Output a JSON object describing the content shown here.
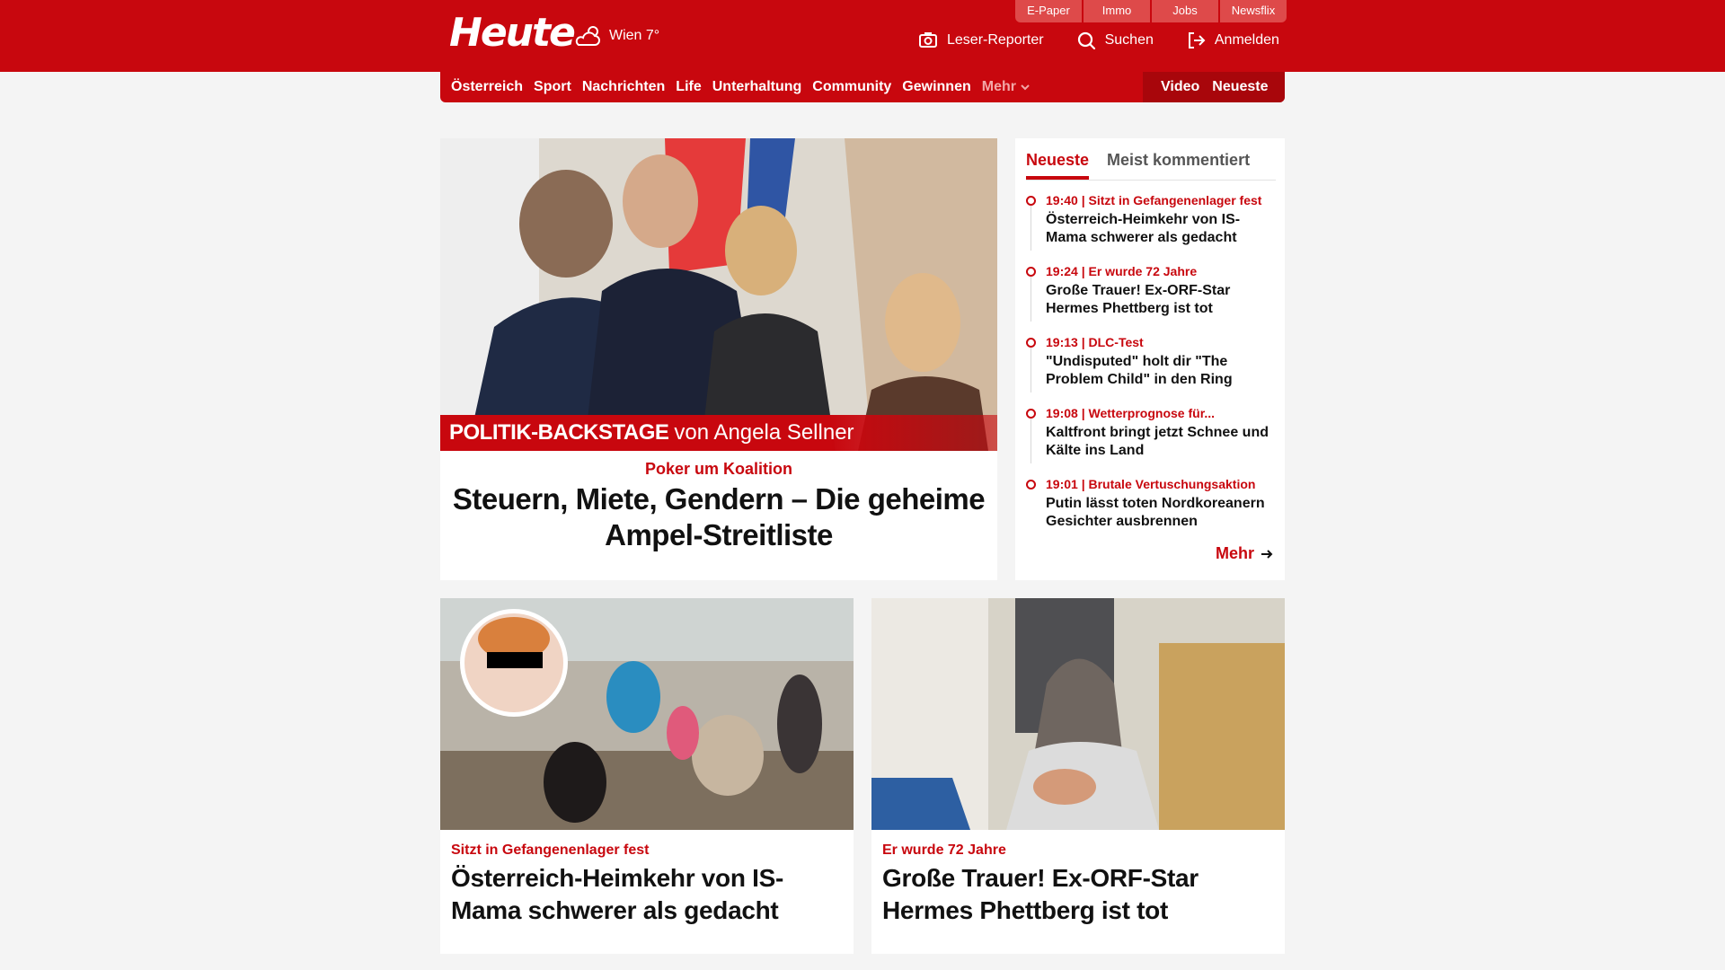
{
  "header": {
    "logo": "Heute",
    "weather": "Wien 7°",
    "service_tabs": [
      "E-Paper",
      "Immo",
      "Jobs",
      "Newsflix"
    ],
    "actions": {
      "leser_reporter": "Leser-Reporter",
      "search": "Suchen",
      "login": "Anmelden"
    },
    "brand_color": "#c8070e"
  },
  "nav": {
    "items": [
      "Österreich",
      "Sport",
      "Nachrichten",
      "Life",
      "Unterhaltung",
      "Community",
      "Gewinnen"
    ],
    "more": "Mehr",
    "right_items": [
      "Video",
      "Neueste"
    ]
  },
  "hero": {
    "banner_bold": "POLITIK-BACKSTAGE",
    "banner_rest": "von Angela Sellner",
    "kicker": "Poker um Koalition",
    "title": "Steuern, Miete, Gendern – Die geheime Ampel-Streitliste"
  },
  "sidebar": {
    "tabs": [
      "Neueste",
      "Meist kommentiert"
    ],
    "items": [
      {
        "meta": "19:40 | Sitzt in Gefangenenlager fest",
        "title": "Österreich-Heimkehr von IS-Mama schwerer als gedacht"
      },
      {
        "meta": "19:24 | Er wurde 72 Jahre",
        "title": "Große Trauer! Ex-ORF-Star Hermes Phettberg ist tot"
      },
      {
        "meta": "19:13 | DLC-Test",
        "title": "\"Undisputed\" holt dir \"The Problem Child\" in den Ring"
      },
      {
        "meta": "19:08 | Wetterprognose für...",
        "title": "Kaltfront bringt jetzt Schnee und Kälte ins Land"
      },
      {
        "meta": "19:01 | Brutale Vertuschungsaktion",
        "title": "Putin lässt toten Nordkoreanern Gesichter ausbrennen"
      }
    ],
    "more": "Mehr"
  },
  "cards": [
    {
      "kicker": "Sitzt in Gefangenenlager fest",
      "title": "Österreich-Heimkehr von IS-Mama schwerer als gedacht"
    },
    {
      "kicker": "Er wurde 72 Jahre",
      "title": "Große Trauer! Ex-ORF-Star Hermes Phettberg ist tot"
    }
  ]
}
